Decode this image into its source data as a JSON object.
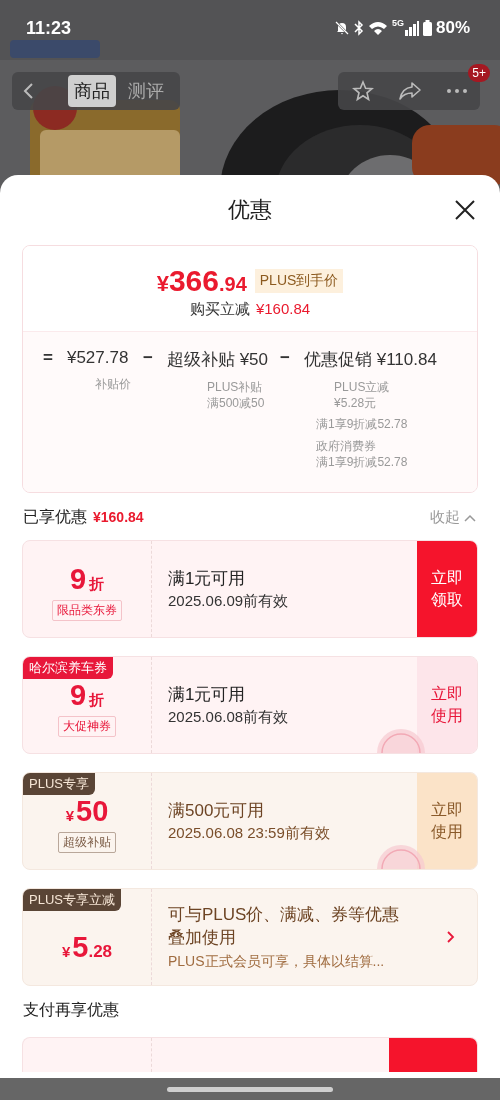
{
  "status_bar": {
    "time": "11:23",
    "network": "5G",
    "battery": "80%"
  },
  "nav": {
    "tabs": [
      {
        "label": "商品",
        "selected": true
      },
      {
        "label": "测评",
        "selected": false
      }
    ],
    "badge": "5+"
  },
  "sheet": {
    "title": "优惠",
    "summary": {
      "currency": "¥",
      "price_int": "366",
      "price_dec": ".94",
      "price_tag": "PLUS到手价",
      "saving_label": "购买立减",
      "saving": "¥160.84"
    },
    "breakdown": [
      {
        "op": "=",
        "text": "¥527.78",
        "notes": [
          [
            "补贴价"
          ]
        ]
      },
      {
        "op": "−",
        "text": "超级补贴 ¥50",
        "notes": [
          [
            "PLUS补贴",
            "满500减50"
          ]
        ]
      },
      {
        "op": "−",
        "text": "优惠促销 ¥110.84",
        "notes": [
          [
            "PLUS立减",
            "¥5.28元"
          ],
          [
            "满1享9折减52.78"
          ],
          [
            "政府消费券",
            "满1享9折减52.78"
          ]
        ]
      }
    ],
    "applied": {
      "label": "已享优惠",
      "amount": "¥160.84",
      "toggle": "收起",
      "expanded": true
    },
    "coupons": [
      {
        "kind": "discount",
        "plus": false,
        "value": "9",
        "unit": "折",
        "tag": "限品类东券",
        "title": "满1元可用",
        "validity": "2025.06.09前有效",
        "action": "立即领取",
        "claimed": false
      },
      {
        "kind": "discount",
        "plus": false,
        "ribbon": "哈尔滨养车券",
        "value": "9",
        "unit": "折",
        "tag": "大促神券",
        "title": "满1元可用",
        "validity": "2025.06.08前有效",
        "action": "立即使用",
        "claimed": true
      },
      {
        "kind": "amount",
        "plus": true,
        "ribbon": "PLUS专享",
        "currency": "¥",
        "value": "50",
        "tag": "超级补贴",
        "title": "满500元可用",
        "validity": "2025.06.08 23:59前有效",
        "action": "立即使用",
        "claimed": true
      },
      {
        "kind": "plus",
        "plus": true,
        "ribbon": "PLUS专享立减",
        "currency": "¥",
        "value": "5",
        "fraction": ".28",
        "title": "可与PLUS价、满减、券等优惠叠加使用",
        "subtitle": "PLUS正式会员可享，具体以结算..."
      }
    ],
    "pay_title": "支付再享优惠",
    "pay_coupons": [
      {
        "claimed": false
      }
    ]
  }
}
